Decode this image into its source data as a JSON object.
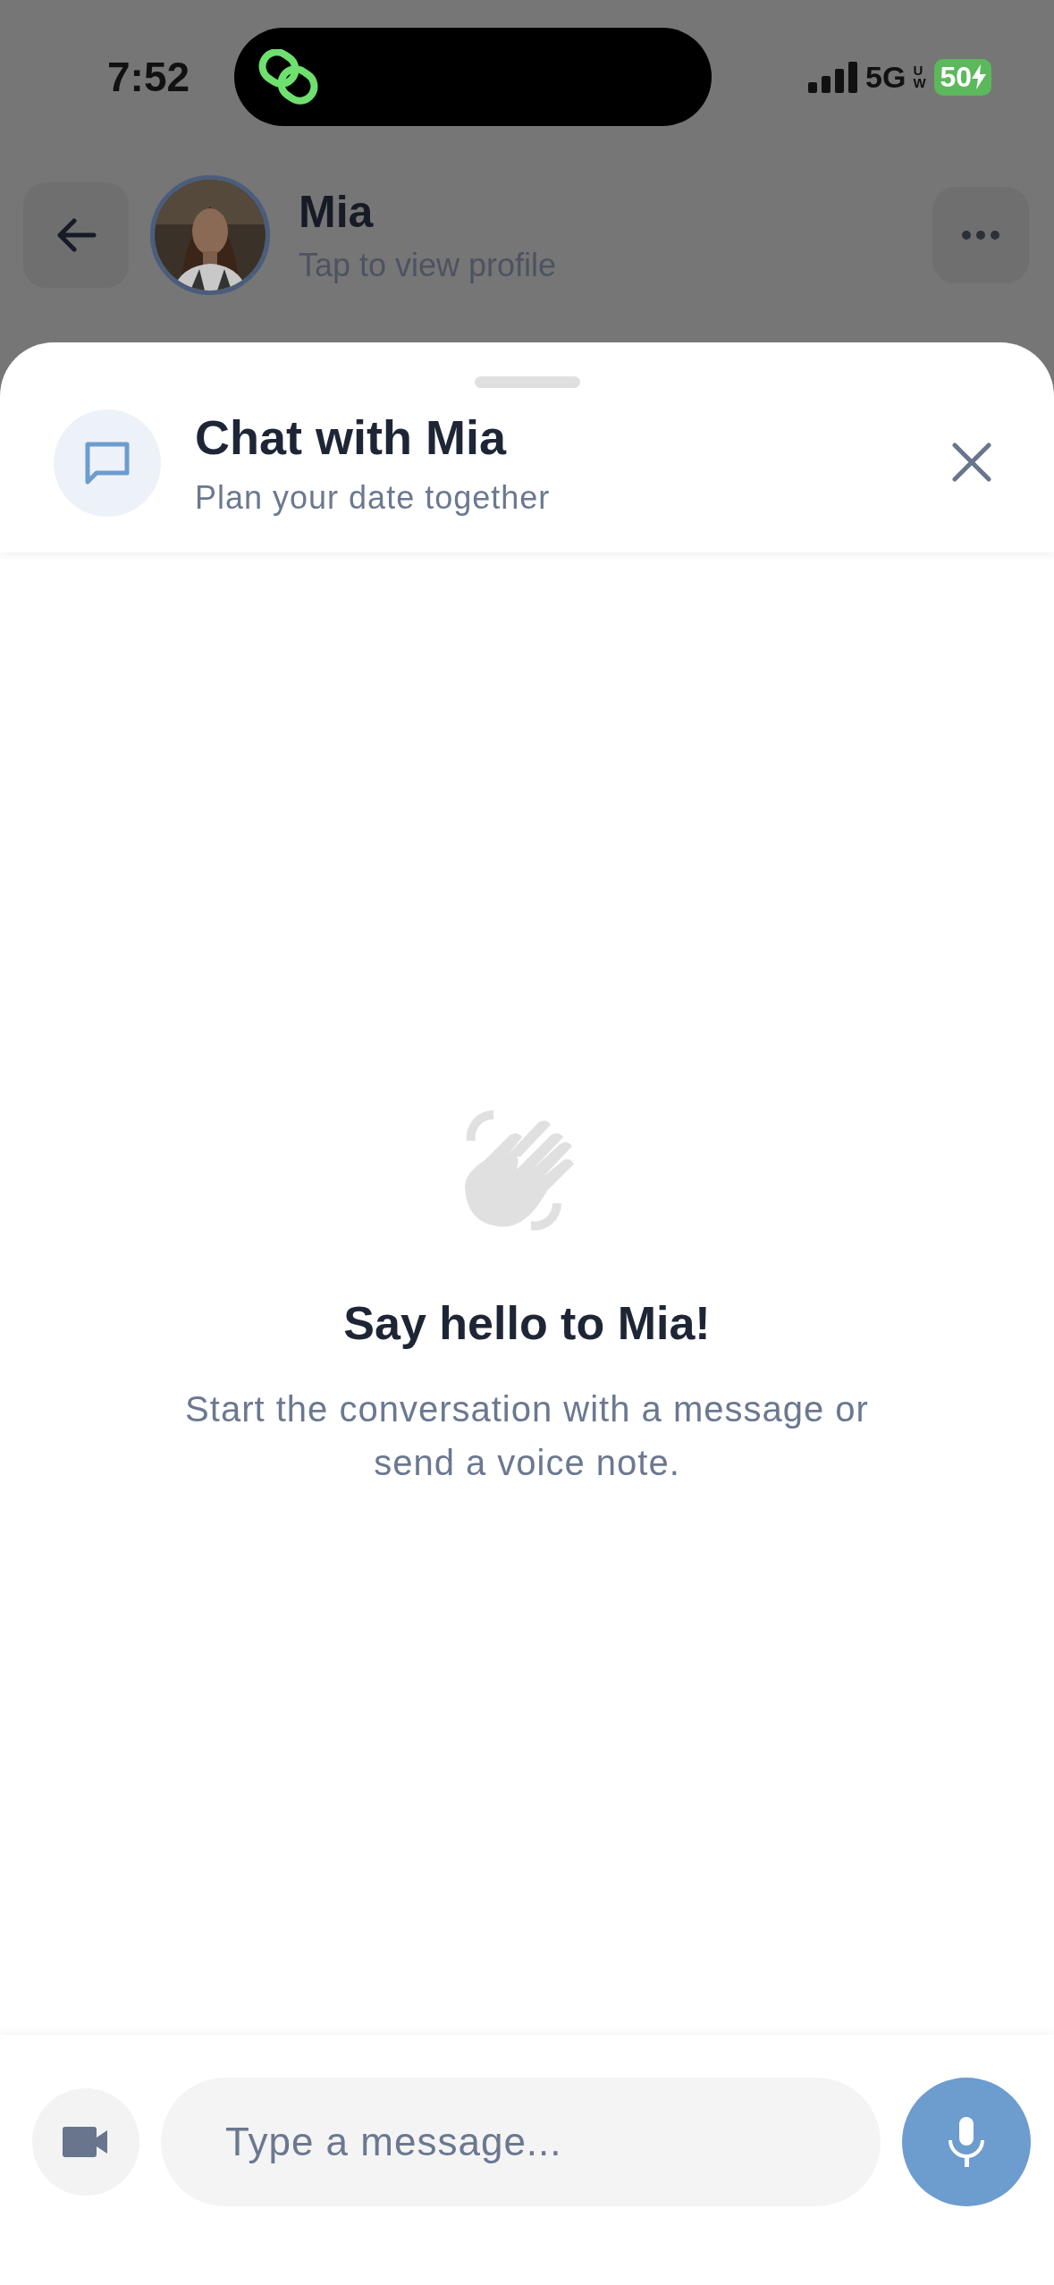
{
  "status_bar": {
    "time": "7:52",
    "network": "5G",
    "network_sub": "UW",
    "battery": "50"
  },
  "header": {
    "name": "Mia",
    "subtitle": "Tap to view profile"
  },
  "sheet": {
    "title": "Chat with Mia",
    "subtitle": "Plan your date together"
  },
  "empty_state": {
    "title": "Say hello to Mia!",
    "text": "Start the conversation with a message or send a voice note."
  },
  "composer": {
    "placeholder": "Type a message..."
  }
}
